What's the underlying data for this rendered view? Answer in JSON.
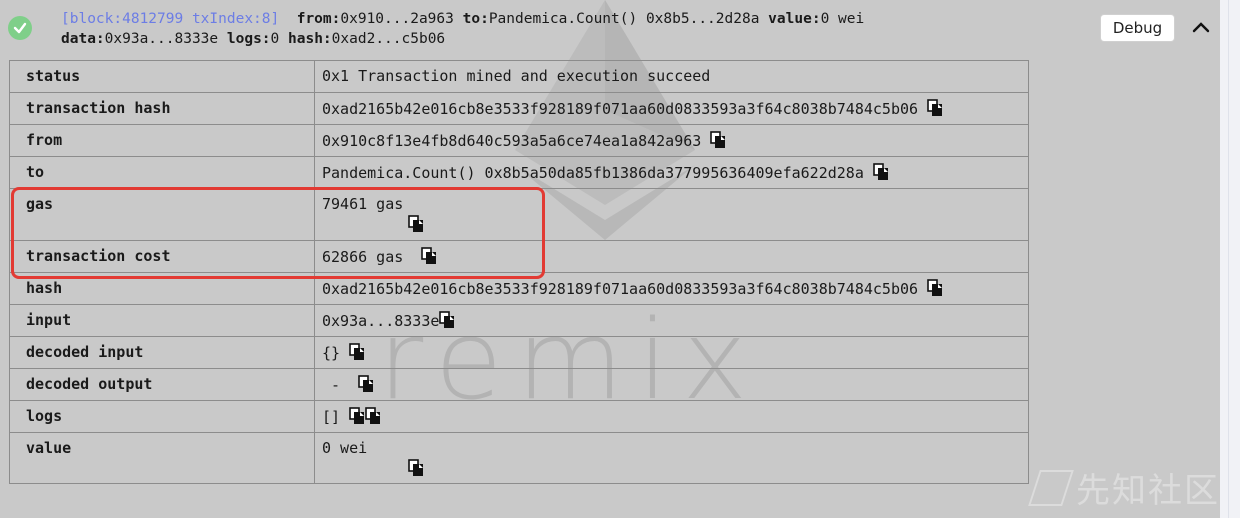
{
  "header": {
    "block": "[block:4812799 txIndex:8]",
    "fields": [
      {
        "key": "from:",
        "value": "0x910...2a963"
      },
      {
        "key": "to:",
        "value": "Pandemica.Count() 0x8b5...2d28a"
      },
      {
        "key": "value:",
        "value": "0 wei"
      },
      {
        "key": "data:",
        "value": "0x93a...8333e"
      },
      {
        "key": "logs:",
        "value": "0"
      },
      {
        "key": "hash:",
        "value": "0xad2...c5b06"
      }
    ],
    "debug_label": "Debug"
  },
  "rows": [
    {
      "key": "status",
      "value": "0x1 Transaction mined and execution succeed"
    },
    {
      "key": "transaction hash",
      "value": "0xad2165b42e016cb8e3533f928189f071aa60d0833593a3f64c8038b7484c5b06"
    },
    {
      "key": "from",
      "value": "0x910c8f13e4fb8d640c593a5a6ce74ea1a842a963"
    },
    {
      "key": "to",
      "value": "Pandemica.Count() 0x8b5a50da85fb1386da377995636409efa622d28a"
    },
    {
      "key": "gas",
      "value": "79461 gas"
    },
    {
      "key": "transaction cost",
      "value": "62866 gas"
    },
    {
      "key": "hash",
      "value": "0xad2165b42e016cb8e3533f928189f071aa60d0833593a3f64c8038b7484c5b06"
    },
    {
      "key": "input",
      "value": "0x93a...8333e"
    },
    {
      "key": "decoded input",
      "value": "{}"
    },
    {
      "key": "decoded output",
      "value": " - "
    },
    {
      "key": "logs",
      "value": "[]"
    },
    {
      "key": "value",
      "value": "0 wei"
    }
  ],
  "watermark": {
    "word": "remix",
    "site": "先知社区"
  },
  "colors": {
    "accent_block": "#6c7de5",
    "success": "#7fcf89",
    "highlight": "#e23a33"
  }
}
